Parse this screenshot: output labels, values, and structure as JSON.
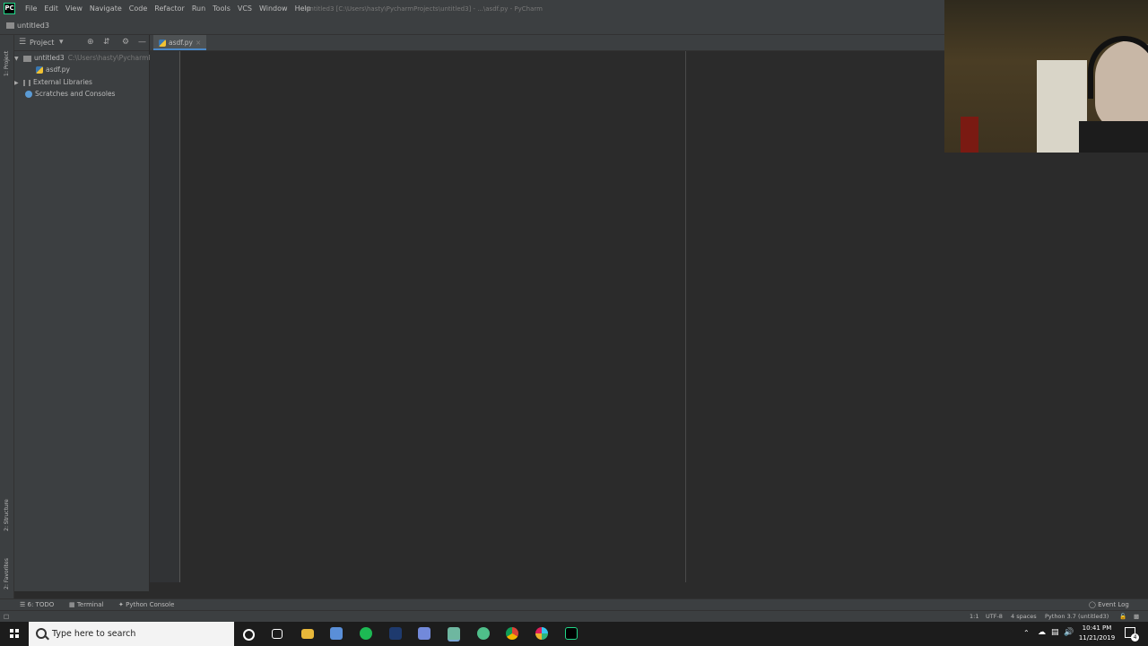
{
  "window": {
    "title": "untitled3 [C:\\Users\\hasty\\PycharmProjects\\untitled3] - ...\\asdf.py - PyCharm",
    "menu": [
      "File",
      "Edit",
      "View",
      "Navigate",
      "Code",
      "Refactor",
      "Run",
      "Tools",
      "VCS",
      "Window",
      "Help"
    ]
  },
  "navbar": {
    "breadcrumb": "untitled3"
  },
  "left_strip": {
    "project": "1: Project",
    "structure": "2: Structure",
    "favorites": "2: Favorites"
  },
  "project_panel": {
    "title": "Project",
    "tree": [
      {
        "label": "untitled3",
        "path": "C:\\Users\\hasty\\PycharmP"
      },
      {
        "label": "asdf.py"
      },
      {
        "label": "External Libraries"
      },
      {
        "label": "Scratches and Consoles"
      }
    ]
  },
  "editor": {
    "tab_label": "asdf.py"
  },
  "bottom_tools": {
    "todo": "6: TODO",
    "terminal": "Terminal",
    "python_console": "Python Console",
    "event_log": "Event Log"
  },
  "status": {
    "position": "1:1",
    "encoding": "UTF-8",
    "indent": "4 spaces",
    "interpreter": "Python 3.7 (untitled3)"
  },
  "taskbar": {
    "search_placeholder": "Type here to search",
    "time": "10:41 PM",
    "date": "11/21/2019",
    "notifications": "4"
  },
  "colors": {
    "ide_bg": "#2b2b2b",
    "panel_bg": "#3c3f41",
    "taskbar_bg": "#1c1c1c",
    "accent": "#4a88c7"
  }
}
